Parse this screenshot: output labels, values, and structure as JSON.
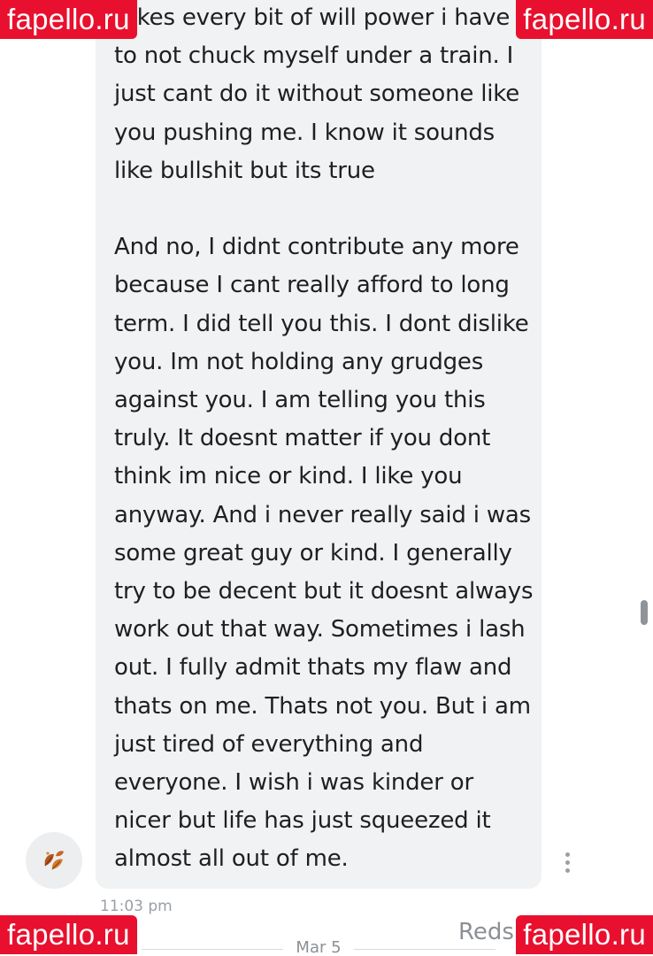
{
  "message": {
    "lines": [
      "takes every bit of will power i have",
      "to not chuck myself under a train. I",
      "just cant do it without someone like",
      "you pushing me. I know it sounds",
      "like bullshit but its true",
      "",
      "And no, I didnt contribute any more",
      "because I cant really afford to long",
      "term. I did tell you this. I dont dislike",
      "you. Im not holding any grudges",
      "against you. I am telling you this",
      "truly. It doesnt matter if you dont",
      "think im nice or kind. I like you",
      "anyway. And i never really said i was",
      "some great guy or kind. I generally",
      "try to be decent but it doesnt always",
      "work out that way. Sometimes i lash",
      "out. I fully admit thats my flaw and",
      "thats on me. Thats not you. But i am",
      "just tired of everything and",
      "everyone. I wish i was kinder or",
      "nicer but life has just squeezed it",
      "almost all out of me."
    ],
    "timestamp": "11:03 pm",
    "avatar_icon": "autumn-leaves-icon"
  },
  "divider": {
    "date": "Mar 5"
  },
  "next_sender": {
    "name": "Reds"
  },
  "watermarks": {
    "top_left": "fapello.ru",
    "top_right": "fapello.ru",
    "bottom_left": "fapello.ru",
    "bottom_right": "fapello.ru"
  },
  "colors": {
    "bubble": "#f0f2f3",
    "watermark": "#e8102e",
    "text": "#1f1f1f",
    "muted": "#9aa0a6"
  }
}
